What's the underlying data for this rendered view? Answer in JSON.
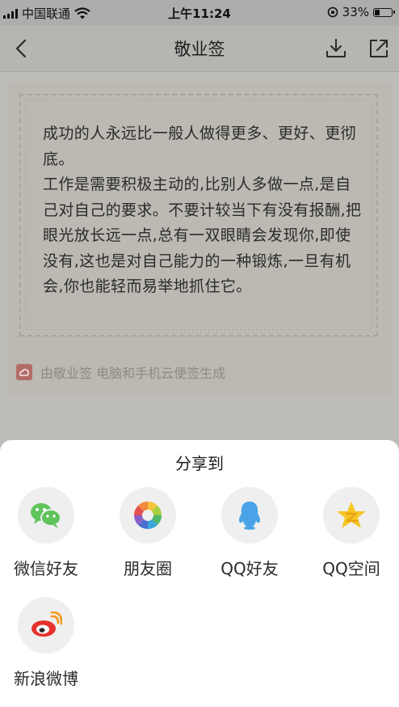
{
  "status_bar": {
    "carrier": "中国联通",
    "time": "上午11:24",
    "battery": "33%",
    "battery_level": 0.33
  },
  "nav": {
    "title": "敬业签"
  },
  "note": {
    "paragraphs": [
      "成功的人永远比一般人做得更多、更好、更彻底。",
      "工作是需要积极主动的,比别人多做一点,是自己对自己的要求。不要计较当下有没有报酬,把眼光放长远一点,总有一双眼睛会发现你,即使没有,这也是对自己能力的一种锻炼,一旦有机会,你也能轻而易举地抓住它。"
    ],
    "footer": "由敬业签 电脑和手机云便签生成"
  },
  "share_sheet": {
    "title": "分享到",
    "targets": [
      {
        "label": "微信好友",
        "icon": "wechat-icon"
      },
      {
        "label": "朋友圈",
        "icon": "moments-icon"
      },
      {
        "label": "QQ好友",
        "icon": "qq-icon"
      },
      {
        "label": "QQ空间",
        "icon": "qzone-icon"
      },
      {
        "label": "新浪微博",
        "icon": "weibo-icon"
      }
    ]
  },
  "colors": {
    "wechat_green": "#5ec45b",
    "qq_blue": "#4aa3e6",
    "qzone_yellow": "#f6c726",
    "weibo_red": "#e5322d",
    "badge_red": "#b36c66"
  }
}
